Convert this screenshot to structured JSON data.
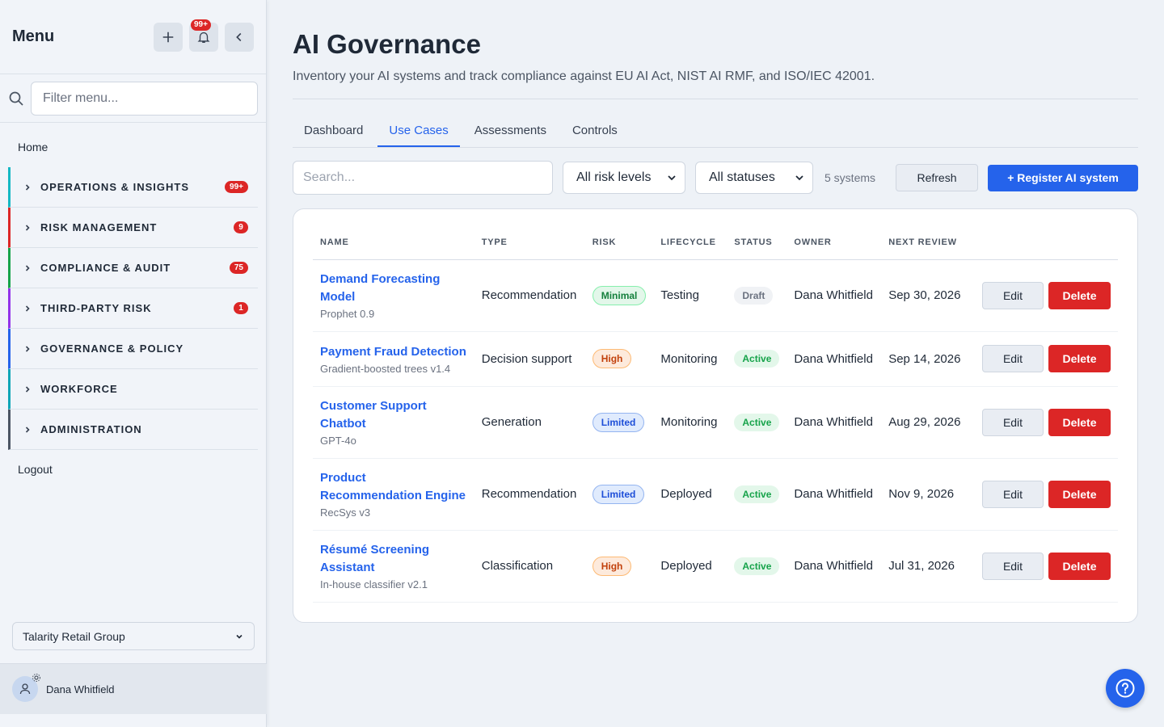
{
  "sidebar": {
    "title": "Menu",
    "notification_badge": "99+",
    "filter_placeholder": "Filter menu...",
    "home": "Home",
    "sections": [
      {
        "label": "OPERATIONS & INSIGHTS",
        "count": "99+",
        "color": "#14b8c4"
      },
      {
        "label": "RISK MANAGEMENT",
        "count": "9",
        "color": "#dc2626"
      },
      {
        "label": "COMPLIANCE & AUDIT",
        "count": "75",
        "color": "#16a34a"
      },
      {
        "label": "THIRD-PARTY RISK",
        "count": "1",
        "color": "#9333ea"
      },
      {
        "label": "GOVERNANCE & POLICY",
        "count": "",
        "color": "#2563eb"
      },
      {
        "label": "WORKFORCE",
        "count": "",
        "color": "#0ea5b7"
      },
      {
        "label": "ADMINISTRATION",
        "count": "",
        "color": "#4b5563"
      }
    ],
    "logout": "Logout",
    "org": "Talarity Retail Group",
    "user": "Dana Whitfield"
  },
  "page": {
    "title": "AI Governance",
    "subtitle": "Inventory your AI systems and track compliance against EU AI Act, NIST AI RMF, and ISO/IEC 42001."
  },
  "tabs": [
    "Dashboard",
    "Use Cases",
    "Assessments",
    "Controls"
  ],
  "active_tab": "Use Cases",
  "toolbar": {
    "search_placeholder": "Search...",
    "risk_filter": "All risk levels",
    "status_filter": "All statuses",
    "count": "5 systems",
    "refresh": "Refresh",
    "register": "+ Register AI system"
  },
  "table": {
    "headers": [
      "NAME",
      "TYPE",
      "RISK",
      "LIFECYCLE",
      "STATUS",
      "OWNER",
      "NEXT REVIEW"
    ],
    "edit_label": "Edit",
    "delete_label": "Delete",
    "rows": [
      {
        "name": "Demand Forecasting Model",
        "model": "Prophet 0.9",
        "type": "Recommendation",
        "risk": "Minimal",
        "lifecycle": "Testing",
        "status": "Draft",
        "owner": "Dana Whitfield",
        "next_review": "Sep 30, 2026"
      },
      {
        "name": "Payment Fraud Detection",
        "model": "Gradient-boosted trees v1.4",
        "type": "Decision support",
        "risk": "High",
        "lifecycle": "Monitoring",
        "status": "Active",
        "owner": "Dana Whitfield",
        "next_review": "Sep 14, 2026"
      },
      {
        "name": "Customer Support Chatbot",
        "model": "GPT-4o",
        "type": "Generation",
        "risk": "Limited",
        "lifecycle": "Monitoring",
        "status": "Active",
        "owner": "Dana Whitfield",
        "next_review": "Aug 29, 2026"
      },
      {
        "name": "Product Recommendation Engine",
        "model": "RecSys v3",
        "type": "Recommendation",
        "risk": "Limited",
        "lifecycle": "Deployed",
        "status": "Active",
        "owner": "Dana Whitfield",
        "next_review": "Nov 9, 2026"
      },
      {
        "name": "Résumé Screening Assistant",
        "model": "In-house classifier v2.1",
        "type": "Classification",
        "risk": "High",
        "lifecycle": "Deployed",
        "status": "Active",
        "owner": "Dana Whitfield",
        "next_review": "Jul 31, 2026"
      }
    ]
  },
  "colors": {
    "accent": "#2563eb",
    "danger": "#dc2626"
  }
}
